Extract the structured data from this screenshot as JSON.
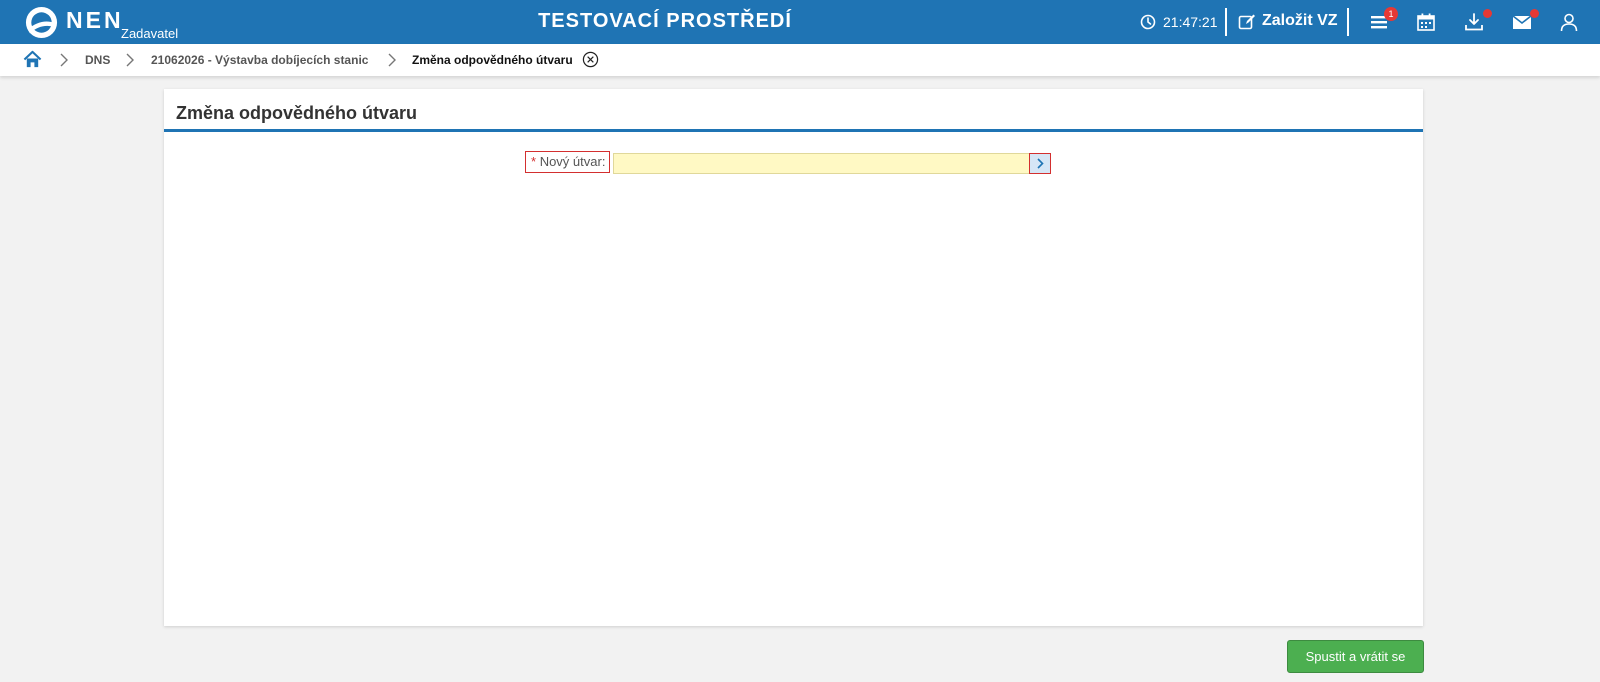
{
  "header": {
    "brand": "NEN",
    "brand_sub": "Zadavatel",
    "environment_title": "TESTOVACÍ PROSTŘEDÍ",
    "clock": "21:47:21",
    "create_label": "Založit VZ",
    "menu_badge": "1",
    "icons": [
      "clock-icon",
      "edit-icon",
      "menu-icon",
      "calendar-icon",
      "download-icon",
      "mail-icon",
      "user-icon"
    ],
    "accent_color": "#1f74b4"
  },
  "breadcrumb": {
    "items": [
      {
        "label": "DNS"
      },
      {
        "label": "21062026 - Výstavba dobíjecích stanic"
      },
      {
        "label": "Změna odpovědného útvaru"
      }
    ]
  },
  "panel": {
    "title": "Změna odpovědného útvaru"
  },
  "form": {
    "new_unit": {
      "required_mark": "*",
      "label": "Nový útvar:",
      "value": ""
    }
  },
  "actions": {
    "run_return_label": "Spustit a vrátit se",
    "run_color": "#4caf50"
  }
}
